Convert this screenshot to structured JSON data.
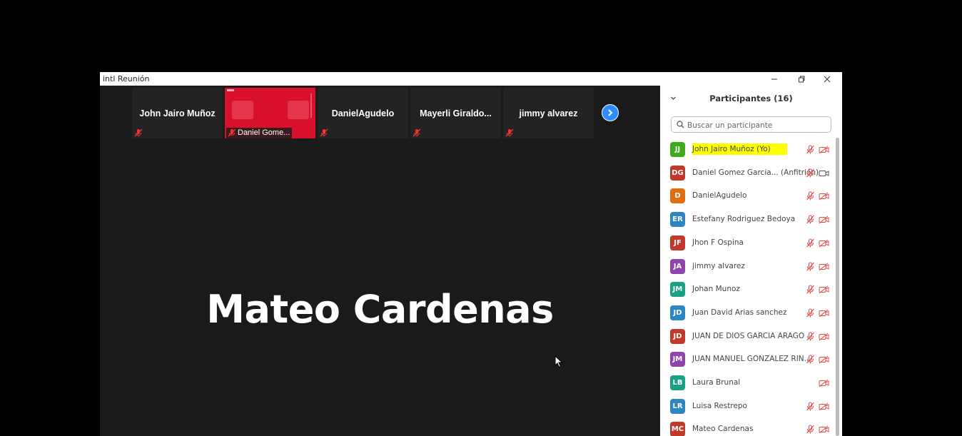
{
  "window": {
    "title": "intl Reunión"
  },
  "thumbnails": [
    {
      "name": "John Jairo Muñoz",
      "muted": true
    },
    {
      "name": "Daniel Gome...",
      "muted": true,
      "sharing": true
    },
    {
      "name": "DanielAgudelo",
      "muted": true
    },
    {
      "name": "Mayerli  Giraldo...",
      "muted": true
    },
    {
      "name": "jimmy alvarez",
      "muted": true
    }
  ],
  "active_speaker": "Mateo Cardenas",
  "participants_panel": {
    "header": "Participantes (16)",
    "search_placeholder": "Buscar un participante",
    "participants": [
      {
        "initials": "JJ",
        "name": "John Jairo Muñoz (Yo)",
        "color": "#3dab1e",
        "highlighted": true,
        "mic": "muted",
        "video": "off"
      },
      {
        "initials": "DG",
        "name": "Daniel Gomez Garcia...  (Anfitrión)",
        "color": "#c0392b",
        "mic": "muted",
        "video": "on"
      },
      {
        "initials": "D",
        "name": "DanielAgudelo",
        "color": "#e06d12",
        "mic": "muted",
        "video": "off"
      },
      {
        "initials": "ER",
        "name": "Estefany Rodriguez Bedoya",
        "color": "#2e86c1",
        "mic": "muted",
        "video": "off"
      },
      {
        "initials": "JF",
        "name": "Jhon F Ospina",
        "color": "#c0392b",
        "mic": "muted",
        "video": "off"
      },
      {
        "initials": "JA",
        "name": "jimmy alvarez",
        "color": "#8e44ad",
        "mic": "muted",
        "video": "off"
      },
      {
        "initials": "JM",
        "name": "Johan Munoz",
        "color": "#1aa085",
        "mic": "muted",
        "video": "off"
      },
      {
        "initials": "JD",
        "name": "Juan David Arias sanchez",
        "color": "#2e86c1",
        "mic": "muted",
        "video": "off"
      },
      {
        "initials": "JD",
        "name": "JUAN DE DIOS GARCIA ARAGO",
        "color": "#c0392b",
        "mic": "muted",
        "video": "off"
      },
      {
        "initials": "JM",
        "name": "JUAN MANUEL GONZALEZ RIN...",
        "color": "#8e44ad",
        "mic": "muted",
        "video": "off"
      },
      {
        "initials": "LB",
        "name": "Laura Brunal",
        "color": "#1aa085",
        "mic": "none",
        "video": "off"
      },
      {
        "initials": "LR",
        "name": "Luisa Restrepo",
        "color": "#2e86c1",
        "mic": "muted",
        "video": "off"
      },
      {
        "initials": "MC",
        "name": "Mateo Cardenas",
        "color": "#c0392b",
        "mic": "muted",
        "video": "off"
      }
    ]
  }
}
